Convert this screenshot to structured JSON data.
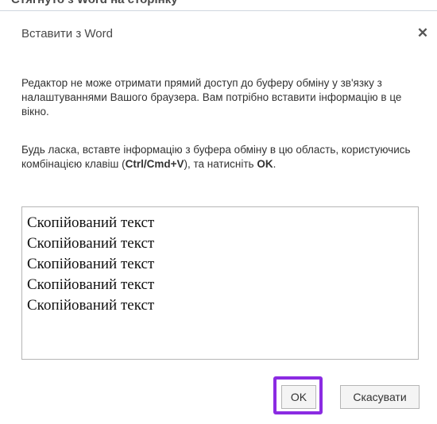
{
  "dialog": {
    "title": "Вставити з Word",
    "close_symbol": "✕"
  },
  "top_strip_text": "Стягнуто з Word на сторінку",
  "message": {
    "paragraph1": "Редактор не може отримати прямий доступ до буферу обміну у зв'язку з налаштуваннями Вашого браузера. Вам потрібно вставити інформацію в це вікно.",
    "paragraph2_start": "Будь ласка, вставте інформацію з буфера обміну в цю область, користуючись комбінацією клавіш (",
    "paragraph2_shortcut": "Ctrl/Cmd+V",
    "paragraph2_middle": "), та натисніть ",
    "paragraph2_ok": "OK",
    "paragraph2_end": "."
  },
  "paste_area": {
    "lines": [
      "Скопійований текст",
      "Скопійований текст",
      "Скопійований текст",
      "Скопійований текст",
      "Скопійований текст"
    ]
  },
  "buttons": {
    "ok_label": "OK",
    "cancel_label": "Скасувати"
  },
  "colors": {
    "highlight": "#8b2be2",
    "text": "#333333",
    "border": "#b6b6b6"
  }
}
